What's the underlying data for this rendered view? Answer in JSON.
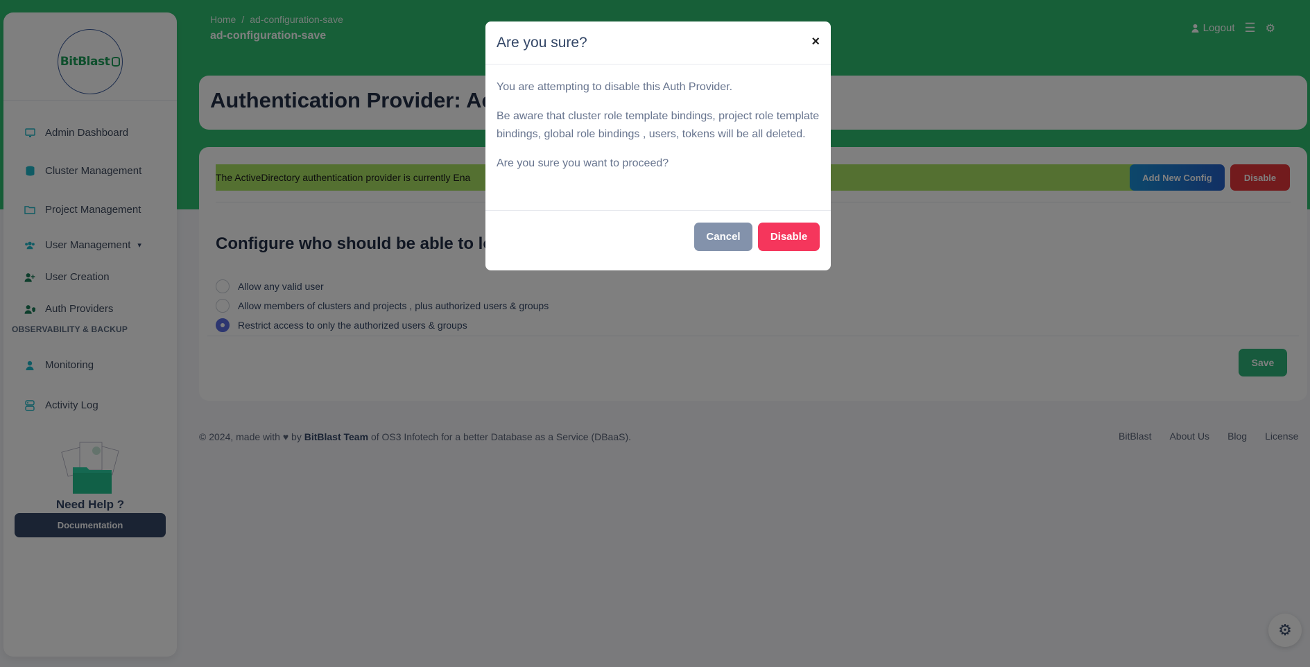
{
  "brand": {
    "logo_text": "BitBlast"
  },
  "sidebar": {
    "items": [
      {
        "label": "Admin Dashboard",
        "icon": "monitor-icon"
      },
      {
        "label": "Cluster Management",
        "icon": "database-icon"
      },
      {
        "label": "Project Management",
        "icon": "folder-icon"
      },
      {
        "label": "User Management",
        "icon": "users-icon"
      },
      {
        "label": "User Creation",
        "icon": "user-plus-icon"
      },
      {
        "label": "Auth Providers",
        "icon": "user-shield-icon"
      }
    ],
    "section_label": "OBSERVABILITY & BACKUP",
    "section_items": [
      {
        "label": "Monitoring",
        "icon": "user-icon"
      },
      {
        "label": "Activity Log",
        "icon": "activity-log-icon"
      }
    ],
    "help_title": "Need Help ?",
    "doc_button": "Documentation"
  },
  "header": {
    "breadcrumb_home": "Home",
    "breadcrumb_current": "ad-configuration-save",
    "page_subtitle": "ad-configuration-save",
    "logout_label": "Logout"
  },
  "main": {
    "title": "Authentication Provider: Act",
    "alert_text": "The ActiveDirectory authentication provider is currently Ena",
    "add_config_label": "Add New Config",
    "disable_label": "Disable",
    "config_title": "Configure who should be able to log",
    "radio_options": [
      {
        "label": "Allow any valid user",
        "checked": false
      },
      {
        "label": "Allow members of clusters and projects , plus authorized users & groups",
        "checked": false
      },
      {
        "label": "Restrict access to only the authorized users & groups",
        "checked": true
      }
    ],
    "save_label": "Save"
  },
  "footer": {
    "copy_prefix": "© 2024, made with",
    "copy_by": "by",
    "team": "BitBlast Team",
    "copy_suffix": "of OS3 Infotech for a better Database as a Service (DBaaS).",
    "links": [
      "BitBlast",
      "About Us",
      "Blog",
      "License"
    ]
  },
  "modal": {
    "title": "Are you sure?",
    "close_glyph": "×",
    "paragraph1": "You are attempting to disable this Auth Provider.",
    "paragraph2": "Be aware that cluster role template bindings, project role template bindings, global role bindings , users, tokens will be all deleted.",
    "paragraph3": "Are you sure you want to proceed?",
    "cancel_label": "Cancel",
    "disable_label": "Disable"
  },
  "colors": {
    "header_green": "#2fbf71",
    "primary_dark": "#344767",
    "danger": "#f5365c",
    "alert_green": "#a8e063"
  }
}
